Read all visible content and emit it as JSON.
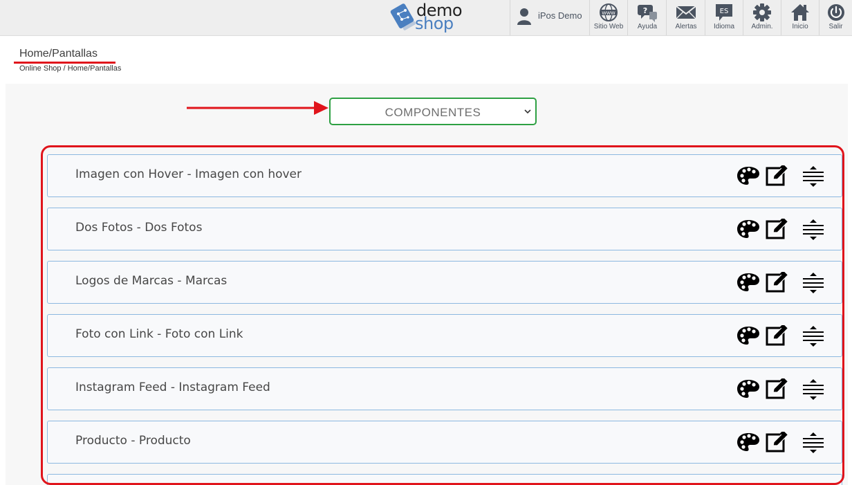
{
  "logo": {
    "word1": "demo",
    "word2": "shop",
    "accent": "#4a7fc0"
  },
  "user": {
    "name": "iPos Demo",
    "icon": "user-icon"
  },
  "nav": [
    {
      "label": "Sitio Web",
      "icon": "globe-www-icon"
    },
    {
      "label": "Ayuda",
      "icon": "help-chat-icon"
    },
    {
      "label": "Alertas",
      "icon": "envelope-icon"
    },
    {
      "label": "Idioma",
      "icon": "language-bubble-icon",
      "badge": "ES"
    },
    {
      "label": "Admin.",
      "icon": "gear-icon"
    },
    {
      "label": "Inicio",
      "icon": "home-icon"
    },
    {
      "label": "Salir",
      "icon": "power-icon"
    }
  ],
  "header": {
    "title": "Home/Pantallas",
    "breadcrumb": "Online Shop / Home/Pantallas"
  },
  "selector": {
    "value": "COMPONENTES",
    "border_color": "#2ea043"
  },
  "annotation": {
    "color": "#e0141b"
  },
  "components": [
    {
      "label": "Imagen con Hover - Imagen con hover"
    },
    {
      "label": "Dos Fotos - Dos Fotos"
    },
    {
      "label": "Logos de Marcas - Marcas"
    },
    {
      "label": "Foto con Link - Foto con Link"
    },
    {
      "label": "Instagram Feed - Instagram Feed"
    },
    {
      "label": "Producto - Producto"
    }
  ],
  "row_actions": [
    "palette-icon",
    "edit-icon",
    "reorder-icon"
  ]
}
